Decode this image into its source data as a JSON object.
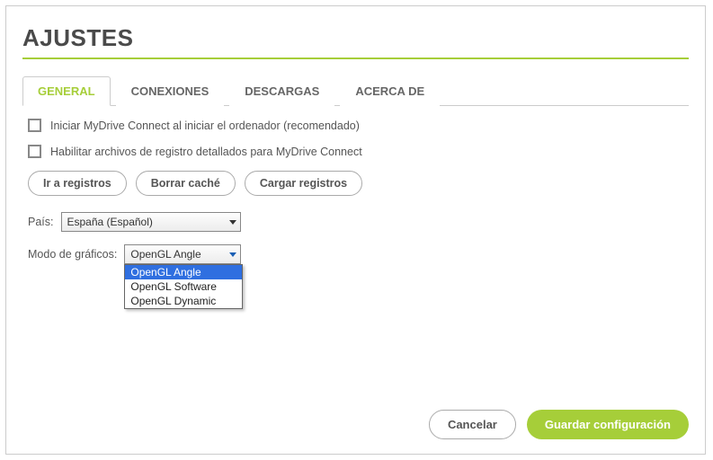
{
  "title": "AJUSTES",
  "tabs": {
    "general": "GENERAL",
    "conexiones": "CONEXIONES",
    "descargas": "DESCARGAS",
    "acerca": "ACERCA DE"
  },
  "checkboxes": {
    "start_on_boot": "Iniciar MyDrive Connect al iniciar el ordenador (recomendado)",
    "enable_logs": "Habilitar archivos de registro detallados para MyDrive Connect"
  },
  "buttons": {
    "go_logs": "Ir a registros",
    "clear_cache": "Borrar caché",
    "upload_logs": "Cargar registros"
  },
  "fields": {
    "country_label": "País:",
    "country_value": "España (Español)",
    "graphics_label": "Modo de gráficos:",
    "graphics_value": "OpenGL Angle",
    "graphics_options": {
      "angle": "OpenGL Angle",
      "software": "OpenGL Software",
      "dynamic": "OpenGL Dynamic"
    }
  },
  "footer": {
    "cancel": "Cancelar",
    "save": "Guardar configuración"
  }
}
